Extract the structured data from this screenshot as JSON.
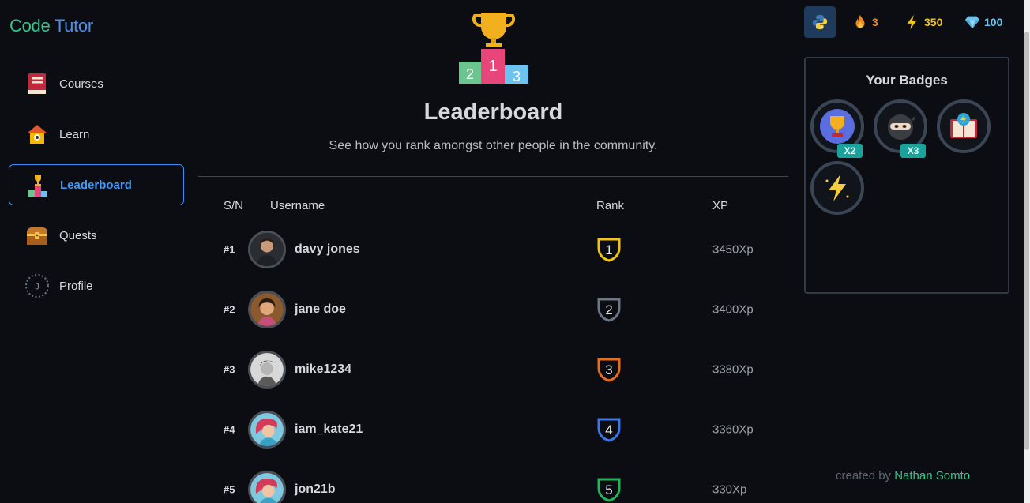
{
  "brand": {
    "part1": "Code",
    "part2": "Tutor"
  },
  "sidebar": {
    "items": [
      {
        "label": "Courses",
        "icon": "book-icon",
        "active": false
      },
      {
        "label": "Learn",
        "icon": "school-icon",
        "active": false
      },
      {
        "label": "Leaderboard",
        "icon": "podium-icon",
        "active": true
      },
      {
        "label": "Quests",
        "icon": "treasure-chest-icon",
        "active": false
      },
      {
        "label": "Profile",
        "icon": "profile-avatar-icon",
        "active": false
      }
    ],
    "profile_initial": "J"
  },
  "main": {
    "title": "Leaderboard",
    "subtitle": "See how you rank amongst other people in the community.",
    "columns": {
      "sn": "S/N",
      "username": "Username",
      "rank": "Rank",
      "xp": "XP"
    },
    "rows": [
      {
        "sn": "#1",
        "username": "davy jones",
        "rank": "1",
        "rank_color": "#f2c417",
        "xp": "3450Xp"
      },
      {
        "sn": "#2",
        "username": "jane doe",
        "rank": "2",
        "rank_color": "#6b7787",
        "xp": "3400Xp"
      },
      {
        "sn": "#3",
        "username": "mike1234",
        "rank": "3",
        "rank_color": "#e96d1b",
        "xp": "3380Xp"
      },
      {
        "sn": "#4",
        "username": "iam_kate21",
        "rank": "4",
        "rank_color": "#3b77e6",
        "xp": "3360Xp"
      },
      {
        "sn": "#5",
        "username": "jon21b",
        "rank": "5",
        "rank_color": "#22b55a",
        "xp": "330Xp"
      }
    ]
  },
  "stats": {
    "language_icon": "python-icon",
    "streak": "3",
    "streak_color": "#f0861f",
    "energy": "350",
    "energy_color": "#f2c417",
    "gems": "100",
    "gems_color": "#6cc3f0"
  },
  "badges": {
    "title": "Your Badges",
    "items": [
      {
        "icon": "trophy-badge-icon",
        "count": "X2"
      },
      {
        "icon": "ninja-badge-icon",
        "count": "X3"
      },
      {
        "icon": "book-lightning-badge-icon",
        "count": ""
      },
      {
        "icon": "lightning-badge-icon",
        "count": ""
      }
    ]
  },
  "footer": {
    "prefix": "created by",
    "author": "Nathan Somto"
  }
}
